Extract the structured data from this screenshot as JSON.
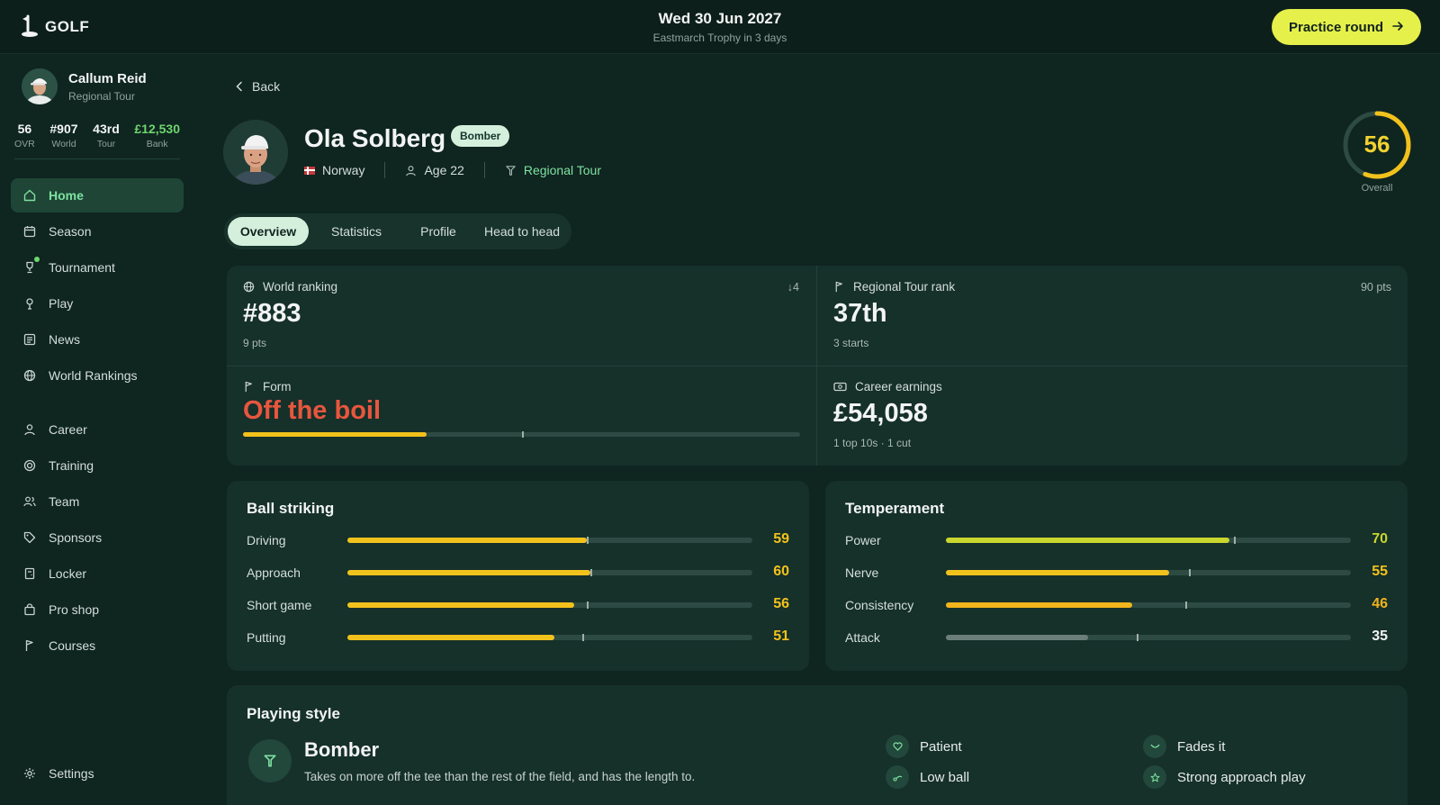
{
  "app": {
    "logo_text": "GOLF"
  },
  "header": {
    "date": "Wed 30 Jun 2027",
    "subtitle": "Eastmarch Trophy in 3 days",
    "practice_label": "Practice round"
  },
  "sidebar": {
    "user": {
      "name": "Callum Reid",
      "tour": "Regional Tour"
    },
    "stats": [
      {
        "value": "56",
        "label": "OVR"
      },
      {
        "value": "#907",
        "label": "World"
      },
      {
        "value": "43rd",
        "label": "Tour"
      },
      {
        "value": "£12,530",
        "label": "Bank"
      }
    ],
    "items": [
      {
        "label": "Home",
        "icon": "home-icon",
        "active": true
      },
      {
        "label": "Season",
        "icon": "calendar-icon"
      },
      {
        "label": "Tournament",
        "icon": "trophy-icon",
        "notification": true
      },
      {
        "label": "Play",
        "icon": "golf-pin-icon"
      },
      {
        "label": "News",
        "icon": "news-icon"
      },
      {
        "label": "World Rankings",
        "icon": "globe-icon"
      },
      {
        "label": "Career",
        "icon": "person-icon"
      },
      {
        "label": "Training",
        "icon": "target-icon"
      },
      {
        "label": "Team",
        "icon": "team-icon"
      },
      {
        "label": "Sponsors",
        "icon": "tag-icon"
      },
      {
        "label": "Locker",
        "icon": "locker-icon"
      },
      {
        "label": "Pro shop",
        "icon": "shopping-bag-icon"
      },
      {
        "label": "Courses",
        "icon": "flag-icon"
      }
    ],
    "settings_label": "Settings"
  },
  "player": {
    "back_label": "Back",
    "name": "Ola Solberg",
    "badge": "Bomber",
    "country": "Norway",
    "age": "Age 22",
    "tour": "Regional Tour",
    "overall": "56",
    "overall_label": "Overall",
    "overall_fraction": 0.56
  },
  "tabs": [
    "Overview",
    "Statistics",
    "Profile",
    "Head to head"
  ],
  "stats": {
    "world_ranking": {
      "label": "World ranking",
      "value": "#883",
      "sub": "9 pts",
      "change": "↓4"
    },
    "tour_rank": {
      "label": "Regional Tour rank",
      "value": "37th",
      "sub": "3 starts",
      "points": "90 pts"
    },
    "form": {
      "label": "Form",
      "value": "Off the boil",
      "level": 0.33,
      "marker": 0.5
    },
    "earnings": {
      "label": "Career earnings",
      "value": "£54,058",
      "sub": "1 top 10s · 1 cut"
    }
  },
  "ball_striking": {
    "title": "Ball striking",
    "rows": [
      {
        "name": "Driving",
        "value": "59",
        "fill": 0.59,
        "tick": 0.59
      },
      {
        "name": "Approach",
        "value": "60",
        "fill": 0.6,
        "tick": 0.6
      },
      {
        "name": "Short game",
        "value": "56",
        "fill": 0.56,
        "tick": 0.59
      },
      {
        "name": "Putting",
        "value": "51",
        "fill": 0.51,
        "tick": 0.58
      }
    ]
  },
  "temperament": {
    "title": "Temperament",
    "rows": [
      {
        "name": "Power",
        "value": "70",
        "fill": 0.7,
        "tick": 0.71,
        "color": "#c8d62e"
      },
      {
        "name": "Nerve",
        "value": "55",
        "fill": 0.55,
        "tick": 0.6,
        "color": "#f2c21c"
      },
      {
        "name": "Consistency",
        "value": "46",
        "fill": 0.46,
        "tick": 0.59,
        "color": "#f2b41c"
      },
      {
        "name": "Attack",
        "value": "35",
        "fill": 0.35,
        "tick": 0.47,
        "color": "#6c7e79"
      }
    ]
  },
  "playing_style": {
    "title": "Playing style",
    "name": "Bomber",
    "description": "Takes on more off the tee than the rest of the field, and has the length to.",
    "traits": [
      "Patient",
      "Fades it",
      "Low ball",
      "Strong approach play"
    ]
  },
  "colors": {
    "accent": "#e6f04a",
    "active_nav": "#7ee2a0",
    "form_red": "#e8563e",
    "bar_yellow": "#f2c21c",
    "overall_ring": "#f2c21c"
  }
}
